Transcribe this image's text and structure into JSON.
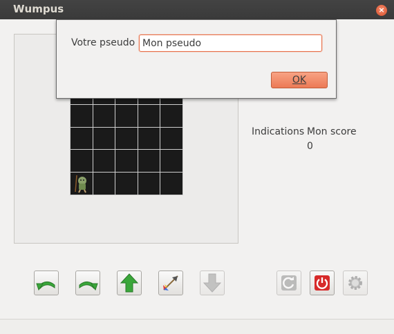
{
  "window": {
    "title": "Wumpus",
    "close_label": "×"
  },
  "dialog": {
    "label": "Votre pseudo",
    "input_value": "Mon pseudo",
    "ok_label": "OK"
  },
  "side": {
    "indications_label": "Indications",
    "score_label": "Mon score",
    "score_value": "0"
  },
  "board": {
    "rows": 5,
    "cols": 5,
    "hero_row": 4,
    "hero_col": 0
  },
  "controls": [
    {
      "name": "turn-left-button",
      "icon": "turn-left-arrow-icon",
      "enabled": true
    },
    {
      "name": "turn-right-button",
      "icon": "turn-right-arrow-icon",
      "enabled": true
    },
    {
      "name": "move-forward-button",
      "icon": "up-arrow-icon",
      "enabled": true
    },
    {
      "name": "shoot-arrow-button",
      "icon": "arrow-projectile-icon",
      "enabled": true
    },
    {
      "name": "move-down-button",
      "icon": "down-arrow-icon",
      "enabled": false
    },
    {
      "name": "restart-button",
      "icon": "refresh-icon",
      "enabled": false
    },
    {
      "name": "quit-button",
      "icon": "power-icon",
      "enabled": true
    },
    {
      "name": "settings-button",
      "icon": "gear-icon",
      "enabled": false
    }
  ],
  "colors": {
    "accent": "#e9724c",
    "board": "#1a1a1a",
    "titlebar": "#3c3c3c"
  }
}
